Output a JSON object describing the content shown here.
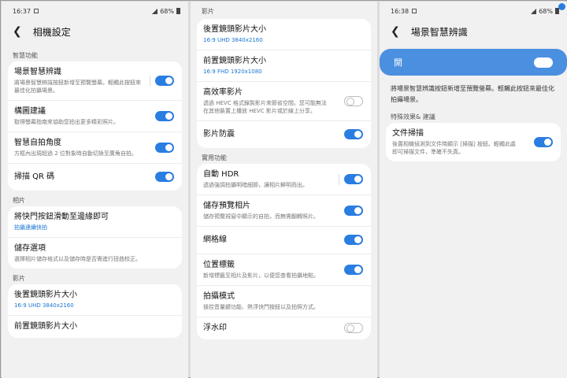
{
  "panel1": {
    "status_time": "16:37",
    "status_battery": "68%",
    "header_title": "相機設定",
    "sections": [
      {
        "label": "智慧功能",
        "items": [
          {
            "title": "場景智慧辨識",
            "sub": "將場景智慧辨識按鈕新增至預覽螢幕。輕觸此按鈕來最佳化拍攝場景。",
            "toggle": "on"
          },
          {
            "title": "構圖建議",
            "sub": "取得螢幕指南來協助您拍出更多精彩照片。",
            "toggle": "on"
          },
          {
            "title": "智慧自拍角度",
            "sub": "方框內出現超過 2 位對象時自動切換至廣角自拍。",
            "toggle": "on"
          },
          {
            "title": "掃描 QR 碼",
            "sub": "",
            "toggle": "on"
          }
        ]
      },
      {
        "label": "相片",
        "items": [
          {
            "title": "將快門按鈕滑動至邊緣即可",
            "sub": "拍攝連續快拍",
            "sub_blue": true
          },
          {
            "title": "儲存選項",
            "sub": "選擇相片儲存格式以及儲存時是否需進行扭曲校正。"
          }
        ]
      },
      {
        "label": "影片",
        "items": [
          {
            "title": "後置鏡頭影片大小",
            "sub": "16:9 UHD 3840x2160",
            "sub_blue": true
          },
          {
            "title": "前置鏡頭影片大小",
            "sub": ""
          }
        ]
      }
    ]
  },
  "panel2": {
    "top_label": "影片",
    "card1": [
      {
        "title": "後置鏡頭影片大小",
        "sub": "16:9 UHD 3840x2160",
        "sub_blue": true
      },
      {
        "title": "前置鏡頭影片大小",
        "sub": "16:9 FHD 1920x1080",
        "sub_blue": true
      },
      {
        "title": "高效率影片",
        "sub": "透過 HEVC 格式錄製影片來節省空間。您可能無法在其他裝置上播放 HEVC 影片或於線上分享。",
        "toggle": "off"
      },
      {
        "title": "影片防震",
        "sub": "",
        "toggle": "on"
      }
    ],
    "section2_label": "實用功能",
    "card2": [
      {
        "title": "自動 HDR",
        "sub": "透過強調拍攝明暗細節，讓相片鮮明而出。",
        "toggle": "on"
      },
      {
        "title": "儲存預覽相片",
        "sub": "儲存預覽視窗中顯示的自拍，而無需翻轉照片。",
        "toggle": "on"
      },
      {
        "title": "網格線",
        "sub": "",
        "toggle": "on"
      },
      {
        "title": "位置標籤",
        "sub": "新增標籤至相片及影片，以便您查看拍攝地點。",
        "toggle": "on"
      },
      {
        "title": "拍攝模式",
        "sub": "操控音量鍵功能、熱浮快門按鈕以及拍照方式。"
      },
      {
        "title": "浮水印",
        "sub": "",
        "toggle": "off"
      }
    ]
  },
  "panel3": {
    "status_time": "16:38",
    "status_battery": "68%",
    "header_title": "場景智慧辨識",
    "hero_label": "開",
    "description": "將場景智慧辨識按鈕新增至預覽螢幕。輕觸此按鈕來最佳化拍攝場景。",
    "section_label": "特殊效果& 建議",
    "item": {
      "title": "文件掃描",
      "sub": "後置相機偵測到文件時顯示 [掃描] 按鈕。輕觸此處即可掃描文件，準確不失真。",
      "toggle": "on"
    }
  },
  "colors": {
    "accent": "#2a7de1",
    "hero": "#4b8fe0",
    "blue_text": "#1976d2",
    "background": "#f1f1f1"
  },
  "icons": {
    "back": "back-arrow-icon"
  }
}
